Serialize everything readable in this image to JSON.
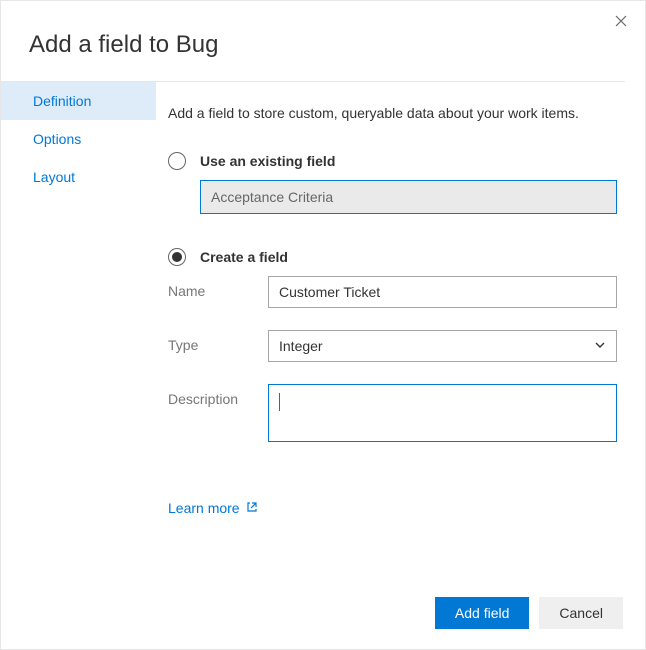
{
  "dialog": {
    "title": "Add a field to Bug",
    "intro": "Add a field to store custom, queryable data about your work items."
  },
  "sidebar": {
    "items": [
      {
        "label": "Definition",
        "active": true
      },
      {
        "label": "Options",
        "active": false
      },
      {
        "label": "Layout",
        "active": false
      }
    ]
  },
  "form": {
    "existing": {
      "radio_label": "Use an existing field",
      "value": "Acceptance Criteria"
    },
    "create": {
      "radio_label": "Create a field",
      "name_label": "Name",
      "name_value": "Customer Ticket",
      "type_label": "Type",
      "type_value": "Integer",
      "description_label": "Description",
      "description_value": ""
    },
    "learn_more": "Learn more"
  },
  "buttons": {
    "primary": "Add field",
    "secondary": "Cancel"
  }
}
